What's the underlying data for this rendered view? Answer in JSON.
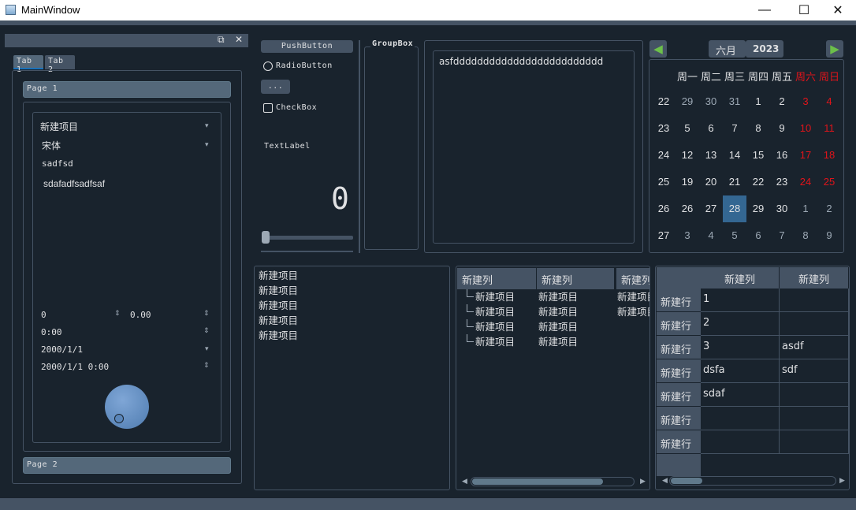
{
  "window": {
    "title": "MainWindow",
    "min_label": "—",
    "max_label": "☐",
    "close_label": "✕"
  },
  "dock": {
    "float_label": "⧉",
    "close_label": "✕"
  },
  "tabs": [
    "Tab 1",
    "Tab 2"
  ],
  "toolbox": {
    "page1": "Page 1",
    "page2": "Page 2"
  },
  "form": {
    "combo1": "新建项目",
    "font_combo": "宋体",
    "line_edit": "sadfsd",
    "text": "sdafadfsadfsaf",
    "spin_int": "0",
    "spin_double": "0.00",
    "time": "0:00",
    "date": "2000/1/1",
    "datetime": "2000/1/1 0:00"
  },
  "widgets": {
    "push_button": "PushButton",
    "radio_button": "RadioButton",
    "tool_button": "...",
    "check_box": "CheckBox",
    "text_label": "TextLabel",
    "lcd_value": "0",
    "slider_value": 0
  },
  "groupbox": {
    "title": "GroupBox"
  },
  "text_edit": {
    "value": "asfddddddddddddddddddddddddd"
  },
  "calendar": {
    "month": "六月",
    "year": "2023",
    "weekdays": [
      "周一",
      "周二",
      "周三",
      "周四",
      "周五",
      "周六",
      "周日"
    ],
    "weeks": [
      "22",
      "23",
      "24",
      "25",
      "26",
      "27"
    ],
    "days": [
      [
        "29",
        "30",
        "31",
        "1",
        "2",
        "3",
        "4"
      ],
      [
        "5",
        "6",
        "7",
        "8",
        "9",
        "10",
        "11"
      ],
      [
        "12",
        "13",
        "14",
        "15",
        "16",
        "17",
        "18"
      ],
      [
        "19",
        "20",
        "21",
        "22",
        "23",
        "24",
        "25"
      ],
      [
        "26",
        "27",
        "28",
        "29",
        "30",
        "1",
        "2"
      ],
      [
        "3",
        "4",
        "5",
        "6",
        "7",
        "8",
        "9"
      ]
    ],
    "selected": "28",
    "weekend_color": "#e0141a",
    "selected_color": "#346792"
  },
  "list": {
    "items": [
      "新建项目",
      "新建项目",
      "新建项目",
      "新建项目",
      "新建项目"
    ]
  },
  "tree": {
    "headers": [
      "新建列",
      "新建列",
      "新建列"
    ],
    "rows": [
      [
        "新建项目",
        "新建项目",
        "新建项目"
      ],
      [
        "新建项目",
        "新建项目",
        "新建项目"
      ],
      [
        "新建项目",
        "新建项目",
        ""
      ],
      [
        "新建项目",
        "新建项目",
        ""
      ]
    ]
  },
  "table": {
    "headers": [
      "新建列",
      "新建列"
    ],
    "row_headers": [
      "新建行",
      "新建行",
      "新建行",
      "新建行",
      "新建行",
      "新建行",
      "新建行"
    ],
    "cells": [
      [
        "1",
        ""
      ],
      [
        "2",
        ""
      ],
      [
        "3",
        "asdf"
      ],
      [
        "dsfa",
        "sdf"
      ],
      [
        "sdaf",
        ""
      ],
      [
        "",
        ""
      ],
      [
        "",
        ""
      ]
    ]
  },
  "colors": {
    "background": "#19232d",
    "panel": "#455364",
    "accent": "#1a72bb"
  }
}
